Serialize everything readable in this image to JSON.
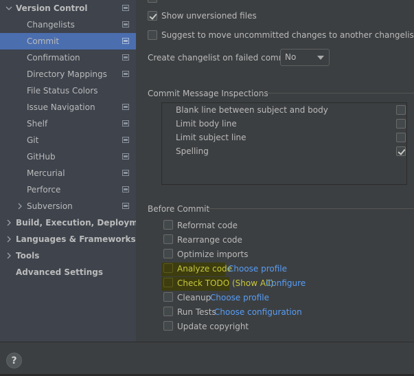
{
  "sidebar": {
    "items": [
      {
        "label": "Version Control",
        "bold": true,
        "expanded": true,
        "has_icon": true
      },
      {
        "label": "Changelists",
        "has_icon": true
      },
      {
        "label": "Commit",
        "selected": true,
        "has_icon": true
      },
      {
        "label": "Confirmation",
        "has_icon": true
      },
      {
        "label": "Directory Mappings",
        "has_icon": true
      },
      {
        "label": "File Status Colors",
        "has_icon": false
      },
      {
        "label": "Issue Navigation",
        "has_icon": true
      },
      {
        "label": "Shelf",
        "has_icon": true
      },
      {
        "label": "Git",
        "has_icon": true
      },
      {
        "label": "GitHub",
        "has_icon": true
      },
      {
        "label": "Mercurial",
        "has_icon": true
      },
      {
        "label": "Perforce",
        "has_icon": true
      },
      {
        "label": "Subversion",
        "collapsed": true,
        "has_icon": true
      },
      {
        "label": "Build, Execution, Deployment",
        "bold": true,
        "collapsed": true
      },
      {
        "label": "Languages & Frameworks",
        "bold": true,
        "collapsed": true
      },
      {
        "label": "Tools",
        "bold": true,
        "collapsed": true
      },
      {
        "label": "Advanced Settings",
        "bold": true
      }
    ]
  },
  "main": {
    "options": {
      "show_unversioned": {
        "label": "Show unversioned files",
        "checked": true
      },
      "suggest_move": {
        "label": "Suggest to move uncommitted changes to another changelist",
        "checked": false
      }
    },
    "create_changelist": {
      "label": "Create changelist on failed commit:",
      "value": "No"
    },
    "inspections": {
      "title": "Commit Message Inspections",
      "items": [
        {
          "label": "Blank line between subject and body",
          "checked": false
        },
        {
          "label": "Limit body line",
          "checked": false
        },
        {
          "label": "Limit subject line",
          "checked": false
        },
        {
          "label": "Spelling",
          "checked": true
        }
      ]
    },
    "before_commit": {
      "title": "Before Commit",
      "items": [
        {
          "label": "Reformat code",
          "checked": false
        },
        {
          "label": "Rearrange code",
          "checked": false
        },
        {
          "label": "Optimize imports",
          "checked": false
        },
        {
          "label": "Analyze code",
          "checked": false,
          "link": "Choose profile",
          "highlighted": true
        },
        {
          "label": "Check TODO (Show All)",
          "checked": false,
          "link": "Configure",
          "highlighted": true
        },
        {
          "label": "Cleanup",
          "checked": false,
          "link": "Choose profile"
        },
        {
          "label": "Run Tests",
          "checked": false,
          "link": "Choose configuration"
        },
        {
          "label": "Update copyright",
          "checked": false
        }
      ]
    }
  },
  "footer": {
    "help_label": "?"
  },
  "colors": {
    "selection": "#4b6eaf",
    "link": "#589df6",
    "highlight": "#3d3d0f"
  }
}
